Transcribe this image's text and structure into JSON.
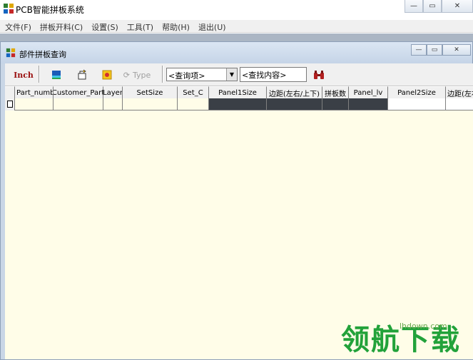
{
  "window": {
    "title": "PCB智能拼板系统",
    "icon": "app-logo-icon"
  },
  "menu": {
    "items": [
      "文件(F)",
      "拼板开料(C)",
      "设置(S)",
      "工具(T)",
      "帮助(H)",
      "退出(U)"
    ]
  },
  "child_window": {
    "title": "部件拼板查询",
    "icon": "app-logo-icon"
  },
  "toolbar": {
    "inch_label": "Inch",
    "type_label": "Type",
    "query_select_value": "<查询项>",
    "search_value": "<查找内容>",
    "icons": [
      "color-bar-icon",
      "export-icon",
      "settings-sun-icon",
      "rotate-icon",
      "binoculars-icon"
    ],
    "colors": {
      "inch": "#9a1010",
      "binoculars": "#b21f1f"
    }
  },
  "grid": {
    "columns": [
      "Part_number",
      "Customer_Part",
      "Layer",
      "SetSize",
      "Set_C",
      "Panel1Size",
      "边距(左右/上下)",
      "拼板数",
      "Panel_lv",
      "Panel2Size",
      "边距(左右/上"
    ],
    "colors": {
      "background": "#fffde8",
      "dark_cell": "#3a3f46"
    }
  },
  "watermark": {
    "url": "lhdown.com",
    "text": "领航下载"
  }
}
